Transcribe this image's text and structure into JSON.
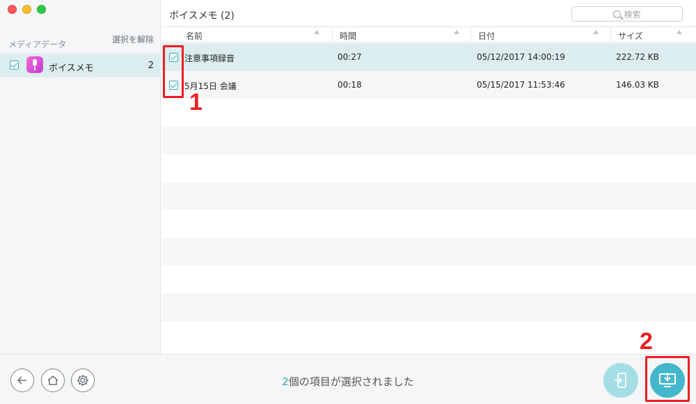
{
  "sidebar": {
    "category_label": "メディアデータ",
    "deselect_label": "選択を解除",
    "items": [
      {
        "label": "ボイスメモ",
        "count": "2",
        "checked": true,
        "icon": "voice-memo-icon"
      }
    ]
  },
  "main": {
    "title": "ボイスメモ (2)",
    "search_placeholder": "検索"
  },
  "table": {
    "headers": {
      "name": "名前",
      "time": "時間",
      "date": "日付",
      "size": "サイズ"
    },
    "rows": [
      {
        "name": "注意事項録音",
        "time": "00:27",
        "date": "05/12/2017 14:00:19",
        "size": "222.72 KB",
        "checked": true
      },
      {
        "name": "5月15日 会議",
        "time": "00:18",
        "date": "05/15/2017 11:53:46",
        "size": "146.03 KB",
        "checked": true
      }
    ]
  },
  "footer": {
    "status_count": "2",
    "status_text": "個の項目が選択されました",
    "buttons": [
      "back-icon",
      "home-icon",
      "settings-icon",
      "export-to-device-icon",
      "export-to-computer-icon"
    ]
  },
  "annotations": {
    "marker_1": "1",
    "marker_2": "2"
  },
  "colors": {
    "accent": "#35a8b5",
    "selected_row": "#dcedef",
    "annotation": "#ee1c24"
  }
}
